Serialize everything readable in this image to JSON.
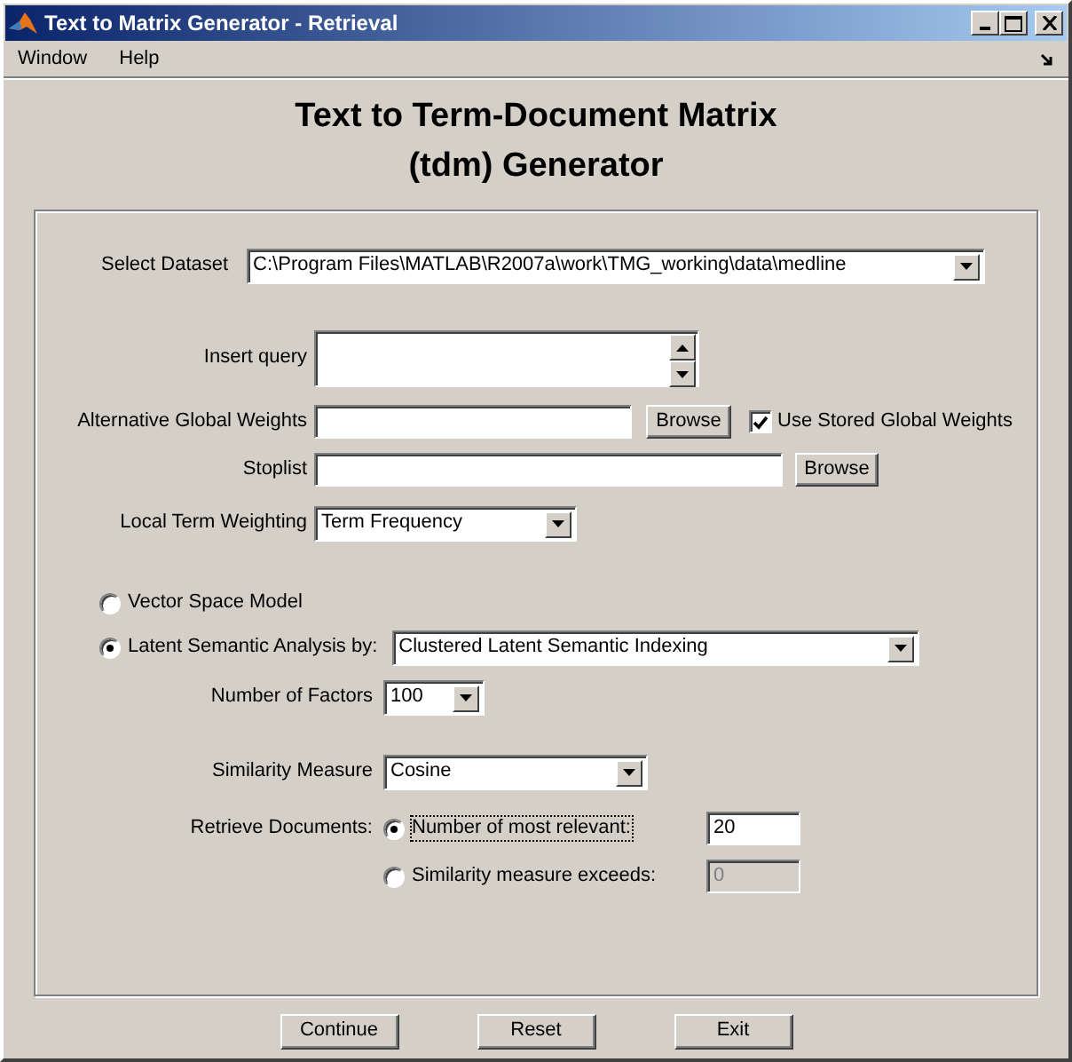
{
  "window": {
    "title": "Text to Matrix Generator - Retrieval"
  },
  "menu": [
    "Window",
    "Help"
  ],
  "heading": [
    "Text to Term-Document Matrix",
    "(tdm) Generator"
  ],
  "dataset": {
    "label": "Select Dataset",
    "value": "C:\\Program Files\\MATLAB\\R2007a\\work\\TMG_working\\data\\medline"
  },
  "query": {
    "label": "Insert query"
  },
  "global_weights": {
    "label": "Alternative Global Weights",
    "button": "Browse",
    "checkbox_label": "Use Stored Global Weights",
    "checked": true
  },
  "stoplist": {
    "label": "Stoplist",
    "button": "Browse"
  },
  "local_weighting": {
    "label": "Local Term Weighting",
    "value": "Term Frequency"
  },
  "models": [
    {
      "kind": "radio",
      "label": "Vector Space Model",
      "selected": false
    },
    {
      "kind": "radio_dropdown",
      "label": "Latent Semantic Analysis by:",
      "selected": true,
      "value": "Clustered Latent Semantic Indexing"
    }
  ],
  "factors": {
    "label": "Number of Factors",
    "value": "100"
  },
  "similarity": {
    "label": "Similarity Measure",
    "value": "Cosine"
  },
  "retrieve": {
    "label": "Retrieve Documents:",
    "options": [
      {
        "label": "Number of most relevant:",
        "selected": true,
        "focused": true,
        "value": "20",
        "disabled": false
      },
      {
        "label": "Similarity measure exceeds:",
        "selected": false,
        "focused": false,
        "value": "0",
        "disabled": true
      }
    ]
  },
  "buttons": [
    "Continue",
    "Reset",
    "Exit"
  ]
}
